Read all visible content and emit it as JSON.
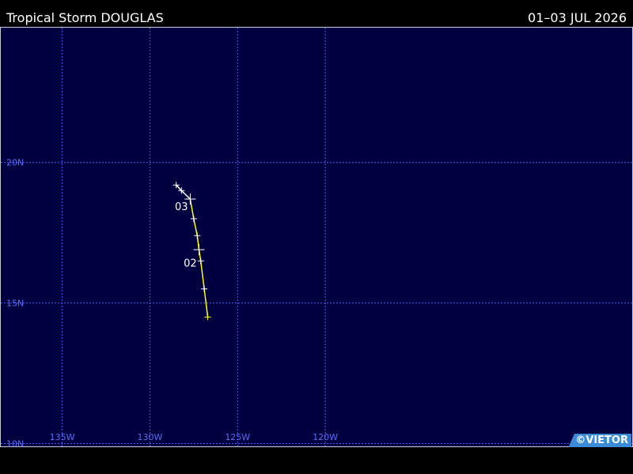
{
  "header": {
    "title": "Tropical Storm DOUGLAS",
    "date_range": "01–03 JUL 2026"
  },
  "credit": "©VIETOR",
  "colors": {
    "ocean": "#000040",
    "grid": "#4a5cf0",
    "track": "#ffff00",
    "track_light": "#ffffff"
  },
  "map": {
    "lon_range": [
      -138.5,
      -102.5
    ],
    "lat_range": [
      9.9,
      24.8
    ],
    "grid_lons": [
      -135,
      -130,
      -125,
      -120
    ],
    "grid_lats": [
      10,
      15,
      20
    ],
    "lon_labels": [
      "135W",
      "130W",
      "125W",
      "120W"
    ],
    "lat_labels": [
      "10N",
      "15N",
      "20N"
    ]
  },
  "track": [
    {
      "lon": -126.7,
      "lat": 14.5
    },
    {
      "lon": -126.9,
      "lat": 15.5
    },
    {
      "lon": -127.1,
      "lat": 16.5
    },
    {
      "lon": -127.2,
      "lat": 16.9
    },
    {
      "lon": -127.3,
      "lat": 17.4
    },
    {
      "lon": -127.5,
      "lat": 18.0
    },
    {
      "lon": -127.7,
      "lat": 18.7
    },
    {
      "lon": -128.2,
      "lat": 19.0
    },
    {
      "lon": -128.5,
      "lat": 19.2
    }
  ],
  "day_labels": [
    {
      "text": "02",
      "lon": -127.7,
      "lat": 16.3
    },
    {
      "text": "03",
      "lon": -128.2,
      "lat": 18.3
    }
  ]
}
